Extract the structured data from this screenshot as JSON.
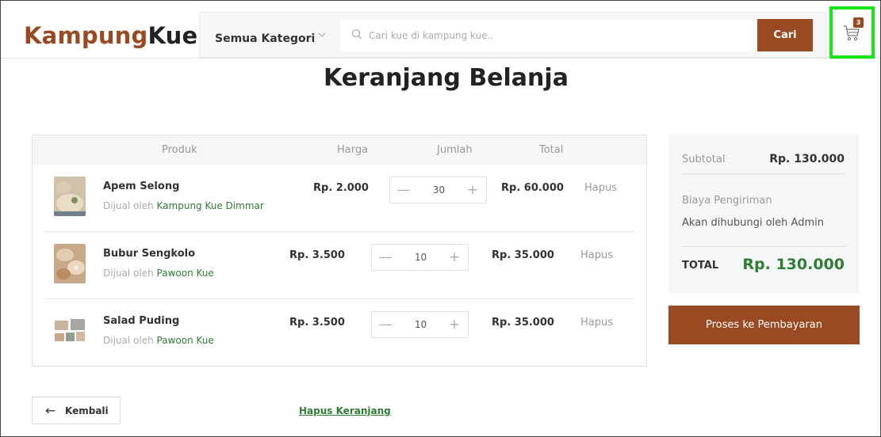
{
  "header": {
    "logo_part1": "Kampung",
    "logo_part2": "Kue",
    "category_select": "Semua Kategori",
    "search_placeholder": "Cari kue di kampung kue..",
    "search_button": "Cari",
    "cart_count": "3",
    "colors": {
      "brand": "#9a4a22",
      "highlight": "#19e619"
    }
  },
  "page": {
    "title": "Keranjang Belanja"
  },
  "table": {
    "headers": {
      "product": "Produk",
      "price": "Harga",
      "qty": "Jumlah",
      "total": "Total"
    },
    "sold_by": "Dijual oleh",
    "remove_label": "Hapus",
    "rows": [
      {
        "name": "Apem Selong",
        "seller": "Kampung Kue Dimmar",
        "price": "Rp. 2.000",
        "qty": "30",
        "total": "Rp. 60.000"
      },
      {
        "name": "Bubur Sengkolo",
        "seller": "Pawoon Kue",
        "price": "Rp. 3.500",
        "qty": "10",
        "total": "Rp. 35.000"
      },
      {
        "name": "Salad Puding",
        "seller": "Pawoon Kue",
        "price": "Rp. 3.500",
        "qty": "10",
        "total": "Rp. 35.000"
      }
    ]
  },
  "summary": {
    "subtotal_label": "Subtotal",
    "subtotal_value": "Rp. 130.000",
    "shipping_label": "Biaya Pengiriman",
    "shipping_value": "Akan dihubungi oleh Admin",
    "total_label": "TOTAL",
    "total_value": "Rp. 130.000"
  },
  "actions": {
    "checkout": "Proses ke Pembayaran",
    "back": "Kembali",
    "clear_cart": "Hapus Keranjang"
  }
}
